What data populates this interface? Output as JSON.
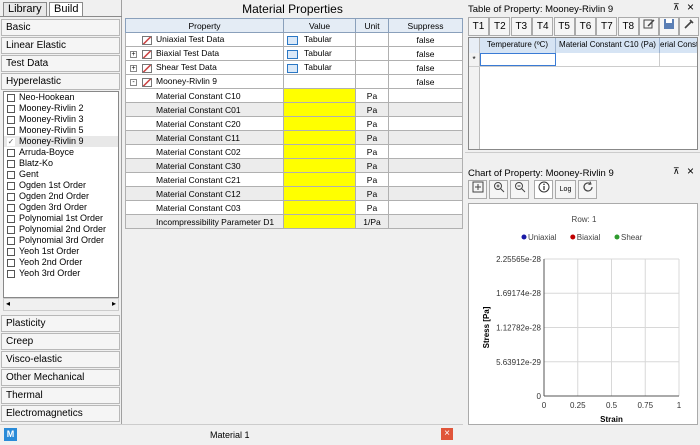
{
  "left": {
    "tabs": [
      "Library",
      "Build"
    ],
    "categories_top": [
      "Basic",
      "Linear Elastic",
      "Test Data",
      "Hyperelastic"
    ],
    "hyperelastic_items": [
      {
        "label": "Neo-Hookean",
        "checked": false
      },
      {
        "label": "Mooney-Rivlin 2",
        "checked": false
      },
      {
        "label": "Mooney-Rivlin 3",
        "checked": false
      },
      {
        "label": "Mooney-Rivlin 5",
        "checked": false
      },
      {
        "label": "Mooney-Rivlin 9",
        "checked": true
      },
      {
        "label": "Arruda-Boyce",
        "checked": false
      },
      {
        "label": "Blatz-Ko",
        "checked": false
      },
      {
        "label": "Gent",
        "checked": false
      },
      {
        "label": "Ogden 1st Order",
        "checked": false
      },
      {
        "label": "Ogden 2nd Order",
        "checked": false
      },
      {
        "label": "Ogden 3rd Order",
        "checked": false
      },
      {
        "label": "Polynomial 1st Order",
        "checked": false
      },
      {
        "label": "Polynomial 2nd Order",
        "checked": false
      },
      {
        "label": "Polynomial 3rd Order",
        "checked": false
      },
      {
        "label": "Yeoh 1st Order",
        "checked": false
      },
      {
        "label": "Yeoh 2nd Order",
        "checked": false
      },
      {
        "label": "Yeoh 3rd Order",
        "checked": false
      }
    ],
    "categories_bottom": [
      "Plasticity",
      "Creep",
      "Visco-elastic",
      "Other Mechanical",
      "Thermal",
      "Electromagnetics"
    ]
  },
  "middle": {
    "title": "Material Properties",
    "headers": [
      "Property",
      "Value",
      "Unit",
      "Suppress"
    ],
    "test_rows": [
      {
        "expander": "",
        "label": "Uniaxial Test Data",
        "value": "Tabular",
        "unit": "",
        "suppress": "false"
      },
      {
        "expander": "+",
        "label": "Biaxial Test Data",
        "value": "Tabular",
        "unit": "",
        "suppress": "false"
      },
      {
        "expander": "+",
        "label": "Shear Test Data",
        "value": "Tabular",
        "unit": "",
        "suppress": "false"
      }
    ],
    "model_row": {
      "expander": "-",
      "label": "Mooney-Rivlin 9",
      "suppress": "false"
    },
    "constants": [
      {
        "label": "Material Constant C10",
        "unit": "Pa"
      },
      {
        "label": "Material Constant C01",
        "unit": "Pa"
      },
      {
        "label": "Material Constant C20",
        "unit": "Pa"
      },
      {
        "label": "Material Constant C11",
        "unit": "Pa"
      },
      {
        "label": "Material Constant C02",
        "unit": "Pa"
      },
      {
        "label": "Material Constant C30",
        "unit": "Pa"
      },
      {
        "label": "Material Constant C21",
        "unit": "Pa"
      },
      {
        "label": "Material Constant C12",
        "unit": "Pa"
      },
      {
        "label": "Material Constant C03",
        "unit": "Pa"
      },
      {
        "label": "Incompressibility Parameter D1",
        "unit": "1/Pa"
      }
    ]
  },
  "right": {
    "table_title": "Table of Property: Mooney-Rivlin 9",
    "table_tabs": [
      "T1",
      "T2",
      "T3",
      "T4",
      "T5",
      "T6",
      "T7",
      "T8"
    ],
    "table_columns": [
      "Temperature (ºC)",
      "Material Constant C10 (Pa)",
      "erial Constant"
    ],
    "table_row_marker": "*",
    "chart_title": "Chart of Property: Mooney-Rivlin 9",
    "chart_log_label": "Log",
    "pin_glyph": "⊼",
    "close_glyph": "×"
  },
  "chart_data": {
    "type": "scatter",
    "title": "Row: 1",
    "xlabel": "Strain",
    "ylabel": "Stress [Pa]",
    "xlim": [
      0,
      1
    ],
    "ylim": [
      0,
      2.25565e-28
    ],
    "x_ticks": [
      "0",
      "0.25",
      "0.5",
      "0.75",
      "1"
    ],
    "y_ticks": [
      "0",
      "5.63912e-29",
      "1.12782e-28",
      "1.69174e-28",
      "2.25565e-28"
    ],
    "series": [
      {
        "name": "Uniaxial",
        "color": "#1a1aa6",
        "values": []
      },
      {
        "name": "Biaxial",
        "color": "#c00000",
        "values": []
      },
      {
        "name": "Shear",
        "color": "#2e9b2e",
        "values": []
      }
    ],
    "grid": true,
    "legend": "top-center"
  },
  "bottom": {
    "tab_label": "Material 1",
    "logo": "M"
  }
}
